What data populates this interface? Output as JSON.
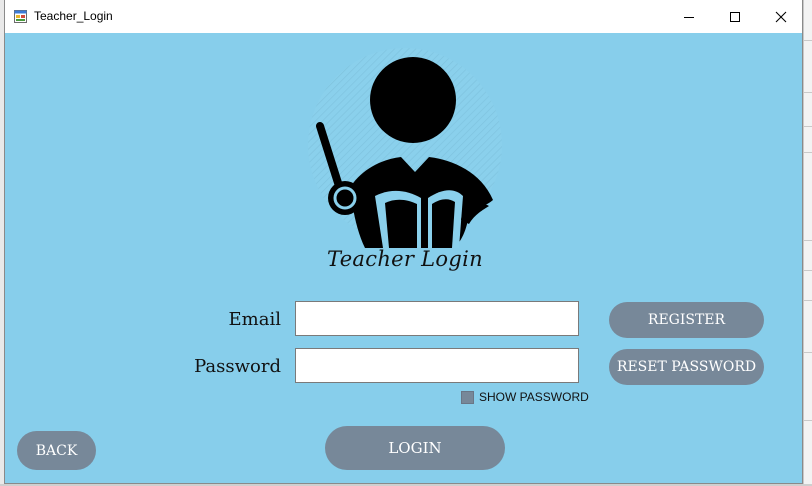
{
  "window": {
    "title": "Teacher_Login"
  },
  "logo": {
    "icon": "teacher-reading-icon"
  },
  "form": {
    "caption": "Teacher Login",
    "email_label": "Email",
    "email_value": "",
    "password_label": "Password",
    "password_value": "",
    "show_password_label": "SHOW PASSWORD",
    "show_password_checked": false
  },
  "buttons": {
    "register": "REGISTER",
    "reset_password": "RESET PASSWORD",
    "login": "LOGIN",
    "back": "BACK"
  },
  "colors": {
    "background": "#87ceeb",
    "button": "#778899",
    "button_text": "#ffffff"
  }
}
